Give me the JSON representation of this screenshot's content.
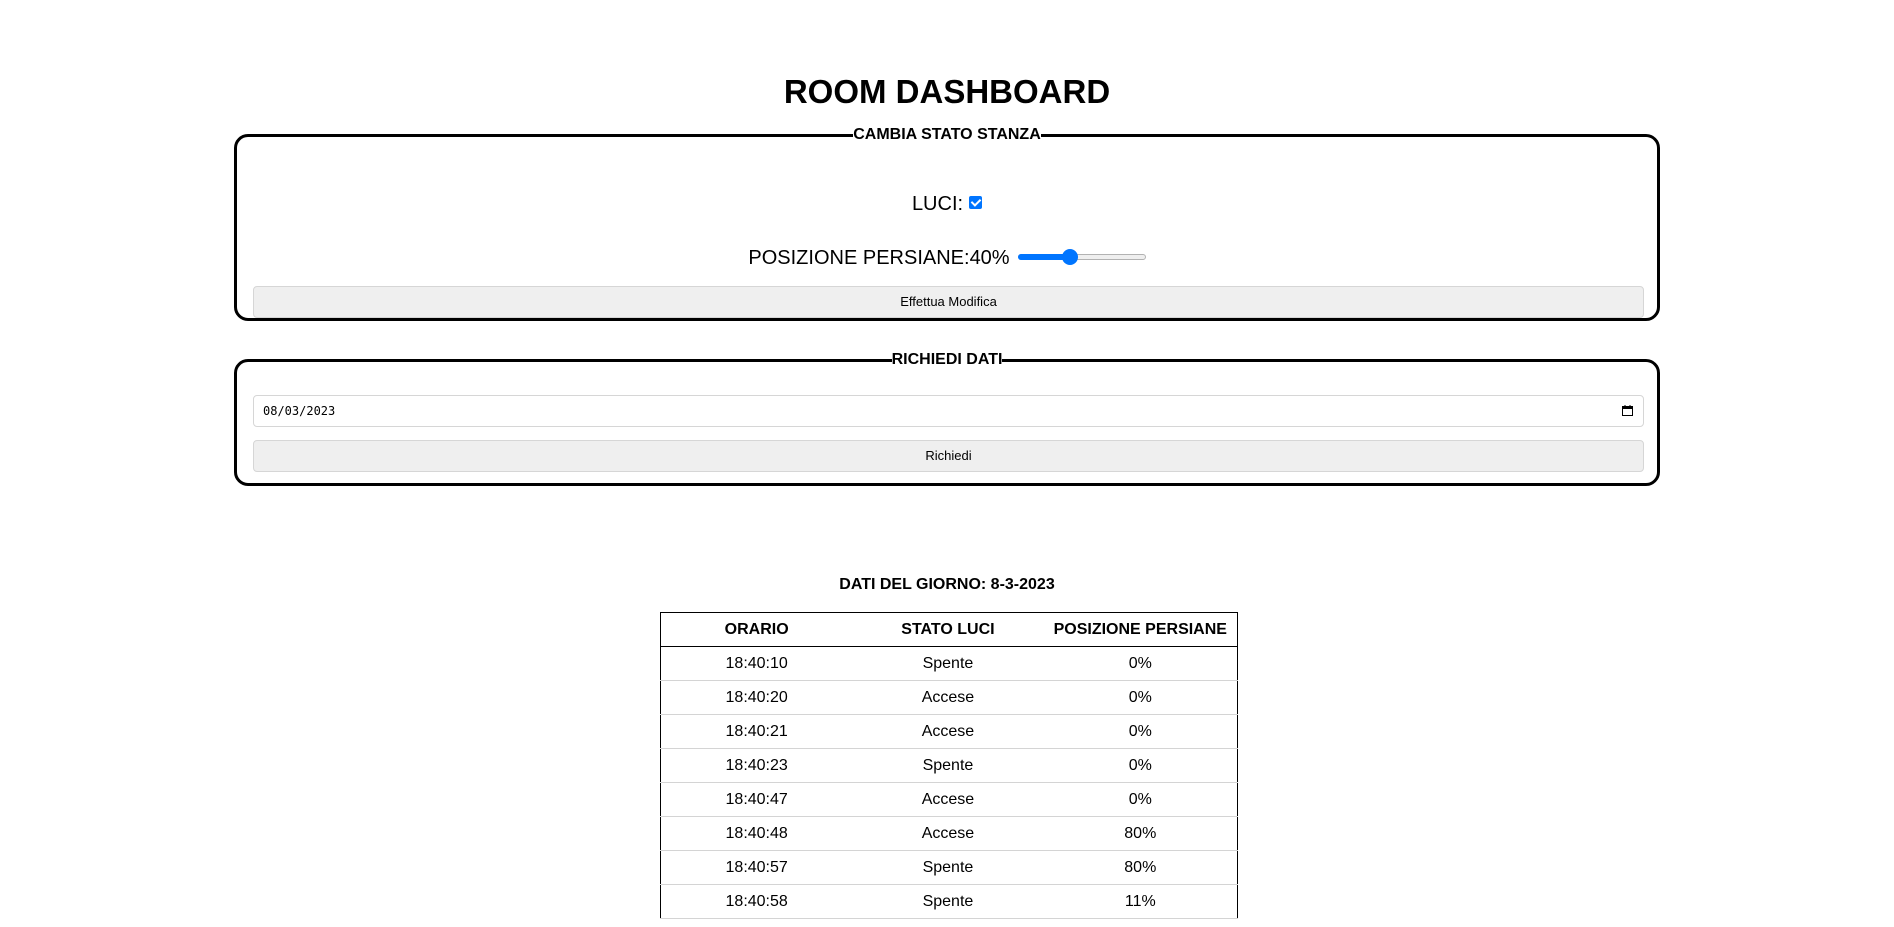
{
  "page": {
    "title": "ROOM DASHBOARD"
  },
  "stato_stanza": {
    "legend": "CAMBIA STATO STANZA",
    "luci_label": "LUCI:",
    "luci_checked": true,
    "persiane_label": "POSIZIONE PERSIANE:",
    "persiane_value_text": "40%",
    "persiane_value": 40,
    "submit_label": "Effettua Modifica"
  },
  "richiedi_dati": {
    "legend": "RICHIEDI DATI",
    "date_value": "08/03/2023",
    "submit_label": "Richiedi"
  },
  "table": {
    "title": "DATI DEL GIORNO: 8-3-2023",
    "headers": [
      "ORARIO",
      "STATO LUCI",
      "POSIZIONE PERSIANE"
    ],
    "rows": [
      [
        "18:40:10",
        "Spente",
        "0%"
      ],
      [
        "18:40:20",
        "Accese",
        "0%"
      ],
      [
        "18:40:21",
        "Accese",
        "0%"
      ],
      [
        "18:40:23",
        "Spente",
        "0%"
      ],
      [
        "18:40:47",
        "Accese",
        "0%"
      ],
      [
        "18:40:48",
        "Accese",
        "80%"
      ],
      [
        "18:40:57",
        "Spente",
        "80%"
      ],
      [
        "18:40:58",
        "Spente",
        "11%"
      ]
    ]
  },
  "colors": {
    "accent": "#0075ff",
    "button_bg": "#efefef",
    "border": "#000000"
  }
}
